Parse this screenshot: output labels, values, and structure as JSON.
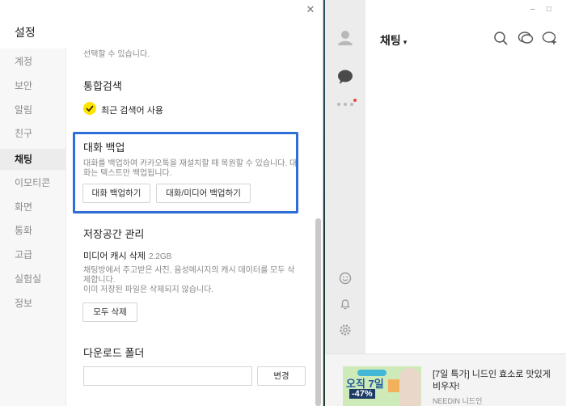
{
  "settings": {
    "title": "설정",
    "close_glyph": "✕",
    "sidebar": [
      {
        "label": "계정"
      },
      {
        "label": "보안"
      },
      {
        "label": "알림"
      },
      {
        "label": "친구"
      },
      {
        "label": "채팅",
        "active": true
      },
      {
        "label": "이모티콘"
      },
      {
        "label": "화면"
      },
      {
        "label": "통화"
      },
      {
        "label": "고급"
      },
      {
        "label": "실험실"
      },
      {
        "label": "정보"
      }
    ],
    "partial_top_text": "선택할 수 있습니다.",
    "search": {
      "title": "통합검색",
      "checkbox_label": "최근 검색어 사용",
      "checked": true
    },
    "backup": {
      "title": "대화 백업",
      "desc_line1": "대화를 백업하여 카카오톡을 재설치할 때 복원할 수 있습니다. 대",
      "desc_line2": "화는 텍스트만 백업됩니다.",
      "btn_text": "대화 백업하기",
      "btn_media": "대화/미디어 백업하기"
    },
    "storage": {
      "title": "저장공간 관리",
      "cache_label": "미디어 캐시 삭제",
      "cache_size": "2.2GB",
      "desc_line1": "채팅방에서 주고받은 사진, 음성메시지의 캐시 데이터를 모두 삭",
      "desc_line2": "제합니다.",
      "desc_line3": "이미 저장된 파일은 삭제되지 않습니다.",
      "delete_all": "모두 삭제"
    },
    "download": {
      "title": "다운로드 폴더",
      "folder_value": "",
      "change_btn": "변경"
    },
    "colors": {
      "highlight_border": "#2e6fd6",
      "check_yellow": "#fee500"
    }
  },
  "kakao": {
    "window_controls": {
      "minimize": "–",
      "maximize": "□"
    },
    "chat_title": "채팅",
    "chat_caret": "▾",
    "ad": {
      "title": "[7일 특가] 니드인 효소로 맛있게 비우자!",
      "brand": "NEEDIN 니드인",
      "image_text1": "오직 7일",
      "image_text2": "-47%"
    }
  }
}
